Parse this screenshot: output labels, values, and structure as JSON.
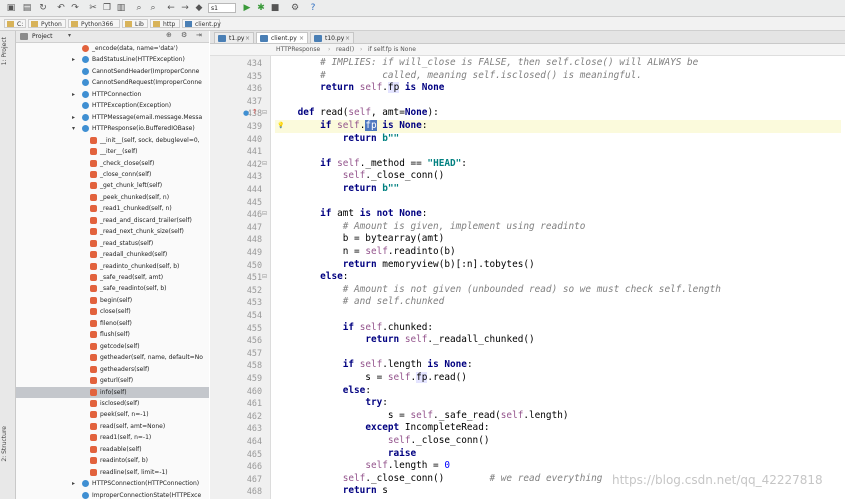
{
  "toolbar": {
    "config": "s1"
  },
  "breadcrumbs": [
    "C:",
    "Python",
    "Python366",
    "Lib",
    "http",
    "client.py"
  ],
  "side_tools": {
    "project": "1: Project",
    "structure": "2: Structure",
    "favorites": "Favorites"
  },
  "project_panel": {
    "title": "Project"
  },
  "tree": [
    {
      "arrow": "",
      "icon": "f",
      "text": "_encode(data, name='data')",
      "indent": 0
    },
    {
      "arrow": "▸",
      "icon": "c",
      "text": "BadStatusLine(HTTPException)",
      "indent": 0
    },
    {
      "arrow": "",
      "icon": "c",
      "text": "CannotSendHeader(ImproperConne",
      "indent": 0
    },
    {
      "arrow": "",
      "icon": "c",
      "text": "CannotSendRequest(ImproperConne",
      "indent": 0
    },
    {
      "arrow": "▸",
      "icon": "c",
      "text": "HTTPConnection",
      "indent": 0
    },
    {
      "arrow": "",
      "icon": "c",
      "text": "HTTPException(Exception)",
      "indent": 0
    },
    {
      "arrow": "▸",
      "icon": "c",
      "text": "HTTPMessage(email.message.Messa",
      "indent": 0
    },
    {
      "arrow": "▾",
      "icon": "c",
      "text": "HTTPResponse(io.BufferedIOBase)",
      "indent": 0
    },
    {
      "arrow": "",
      "icon": "m",
      "text": "__init__(self, sock, debuglevel=0,",
      "indent": 1
    },
    {
      "arrow": "",
      "icon": "m",
      "text": "__iter__(self)",
      "indent": 1
    },
    {
      "arrow": "",
      "icon": "m",
      "text": "_check_close(self)",
      "indent": 1
    },
    {
      "arrow": "",
      "icon": "m",
      "text": "_close_conn(self)",
      "indent": 1
    },
    {
      "arrow": "",
      "icon": "m",
      "text": "_get_chunk_left(self)",
      "indent": 1
    },
    {
      "arrow": "",
      "icon": "m",
      "text": "_peek_chunked(self, n)",
      "indent": 1
    },
    {
      "arrow": "",
      "icon": "m",
      "text": "_read1_chunked(self, n)",
      "indent": 1
    },
    {
      "arrow": "",
      "icon": "m",
      "text": "_read_and_discard_trailer(self)",
      "indent": 1
    },
    {
      "arrow": "",
      "icon": "m",
      "text": "_read_next_chunk_size(self)",
      "indent": 1
    },
    {
      "arrow": "",
      "icon": "m",
      "text": "_read_status(self)",
      "indent": 1
    },
    {
      "arrow": "",
      "icon": "m",
      "text": "_readall_chunked(self)",
      "indent": 1
    },
    {
      "arrow": "",
      "icon": "m",
      "text": "_readinto_chunked(self, b)",
      "indent": 1
    },
    {
      "arrow": "",
      "icon": "m",
      "text": "_safe_read(self, amt)",
      "indent": 1
    },
    {
      "arrow": "",
      "icon": "m",
      "text": "_safe_readinto(self, b)",
      "indent": 1
    },
    {
      "arrow": "",
      "icon": "m",
      "text": "begin(self)",
      "indent": 1
    },
    {
      "arrow": "",
      "icon": "m",
      "text": "close(self)",
      "indent": 1
    },
    {
      "arrow": "",
      "icon": "m",
      "text": "fileno(self)",
      "indent": 1
    },
    {
      "arrow": "",
      "icon": "m",
      "text": "flush(self)",
      "indent": 1
    },
    {
      "arrow": "",
      "icon": "m",
      "text": "getcode(self)",
      "indent": 1
    },
    {
      "arrow": "",
      "icon": "m",
      "text": "getheader(self, name, default=No",
      "indent": 1
    },
    {
      "arrow": "",
      "icon": "m",
      "text": "getheaders(self)",
      "indent": 1
    },
    {
      "arrow": "",
      "icon": "m",
      "text": "geturl(self)",
      "indent": 1
    },
    {
      "arrow": "",
      "icon": "m",
      "text": "info(self)",
      "indent": 1,
      "selected": true
    },
    {
      "arrow": "",
      "icon": "m",
      "text": "isclosed(self)",
      "indent": 1
    },
    {
      "arrow": "",
      "icon": "m",
      "text": "peek(self, n=-1)",
      "indent": 1
    },
    {
      "arrow": "",
      "icon": "m",
      "text": "read(self, amt=None)",
      "indent": 1
    },
    {
      "arrow": "",
      "icon": "m",
      "text": "read1(self, n=-1)",
      "indent": 1
    },
    {
      "arrow": "",
      "icon": "m",
      "text": "readable(self)",
      "indent": 1
    },
    {
      "arrow": "",
      "icon": "m",
      "text": "readinto(self, b)",
      "indent": 1
    },
    {
      "arrow": "",
      "icon": "m",
      "text": "readline(self, limit=-1)",
      "indent": 1
    },
    {
      "arrow": "▸",
      "icon": "c",
      "text": "HTTPSConnection(HTTPConnection)",
      "indent": 0
    },
    {
      "arrow": "",
      "icon": "c",
      "text": "ImproperConnectionState(HTTPExce",
      "indent": 0
    }
  ],
  "tabs": [
    {
      "label": "t1.py",
      "active": false
    },
    {
      "label": "client.py",
      "active": true
    },
    {
      "label": "t10.py",
      "active": false
    }
  ],
  "editor_breadcrumb": [
    "HTTPResponse",
    "read()",
    "if self.fp is None"
  ],
  "watermark": "https://blog.csdn.net/qq_42227818",
  "code_lines": [
    {
      "n": "434",
      "html": "        <span class=\"cm\"># IMPLIES: if will_close is FALSE, then self.close() will ALWAYS be</span>"
    },
    {
      "n": "435",
      "html": "        <span class=\"cm\">#          called, meaning self.isclosed() is meaningful.</span>"
    },
    {
      "n": "436",
      "html": "        <span class=\"kw\">return</span> <span class=\"sf\">self</span>.<span class=\"occ\">fp</span> <span class=\"kw\">is None</span>"
    },
    {
      "n": "437",
      "html": ""
    },
    {
      "n": "438",
      "html": "    <span class=\"kw\">def</span> <span class=\"fn\">read</span>(<span class=\"sf\">self</span>, amt=<span class=\"kw\">None</span>):"
    },
    {
      "n": "439",
      "html": "        <span class=\"kw\">if</span> <span class=\"sf\">self</span>.<span class=\"caret\">fp</span> <span class=\"kw\">is None</span>:",
      "hl": true
    },
    {
      "n": "440",
      "html": "            <span class=\"kw\">return</span> <span class=\"st\">b\"\"</span>"
    },
    {
      "n": "441",
      "html": ""
    },
    {
      "n": "442",
      "html": "        <span class=\"kw\">if</span> <span class=\"sf\">self</span>._method == <span class=\"st\">\"HEAD\"</span>:"
    },
    {
      "n": "443",
      "html": "            <span class=\"sf\">self</span>._close_conn()"
    },
    {
      "n": "444",
      "html": "            <span class=\"kw\">return</span> <span class=\"st\">b\"\"</span>"
    },
    {
      "n": "445",
      "html": ""
    },
    {
      "n": "446",
      "html": "        <span class=\"kw\">if</span> amt <span class=\"kw\">is not None</span>:"
    },
    {
      "n": "447",
      "html": "            <span class=\"cm\"># Amount is given, implement using readinto</span>"
    },
    {
      "n": "448",
      "html": "            b = bytearray(amt)"
    },
    {
      "n": "449",
      "html": "            n = <span class=\"sf\">self</span>.readinto(b)"
    },
    {
      "n": "450",
      "html": "            <span class=\"kw\">return</span> memoryview(b)[:n].tobytes()"
    },
    {
      "n": "451",
      "html": "        <span class=\"kw\">else</span>:"
    },
    {
      "n": "452",
      "html": "            <span class=\"cm\"># Amount is not given (unbounded read) so we must check self.length</span>"
    },
    {
      "n": "453",
      "html": "            <span class=\"cm\"># and self.chunked</span>"
    },
    {
      "n": "454",
      "html": ""
    },
    {
      "n": "455",
      "html": "            <span class=\"kw\">if</span> <span class=\"sf\">self</span>.chunked:"
    },
    {
      "n": "456",
      "html": "                <span class=\"kw\">return</span> <span class=\"sf\">self</span>._readall_chunked()"
    },
    {
      "n": "457",
      "html": ""
    },
    {
      "n": "458",
      "html": "            <span class=\"kw\">if</span> <span class=\"sf\">self</span>.length <span class=\"kw\">is None</span>:"
    },
    {
      "n": "459",
      "html": "                s = <span class=\"sf\">self</span>.<span class=\"occ\">fp</span>.read()"
    },
    {
      "n": "460",
      "html": "            <span class=\"kw\">else</span>:"
    },
    {
      "n": "461",
      "html": "                <span class=\"kw\">try</span>:"
    },
    {
      "n": "462",
      "html": "                    s = <span class=\"sf\">self</span>._safe_read(<span class=\"sf\">self</span>.length)"
    },
    {
      "n": "463",
      "html": "                <span class=\"kw\">except</span> IncompleteRead:"
    },
    {
      "n": "464",
      "html": "                    <span class=\"sf\">self</span>._close_conn()"
    },
    {
      "n": "465",
      "html": "                    <span class=\"kw\">raise</span>"
    },
    {
      "n": "466",
      "html": "                <span class=\"sf\">self</span>.length = <span class=\"nm\">0</span>"
    },
    {
      "n": "467",
      "html": "            <span class=\"sf\">self</span>._close_conn()        <span class=\"cm\"># we read everything</span>"
    },
    {
      "n": "468",
      "html": "            <span class=\"kw\">return</span> s"
    }
  ]
}
